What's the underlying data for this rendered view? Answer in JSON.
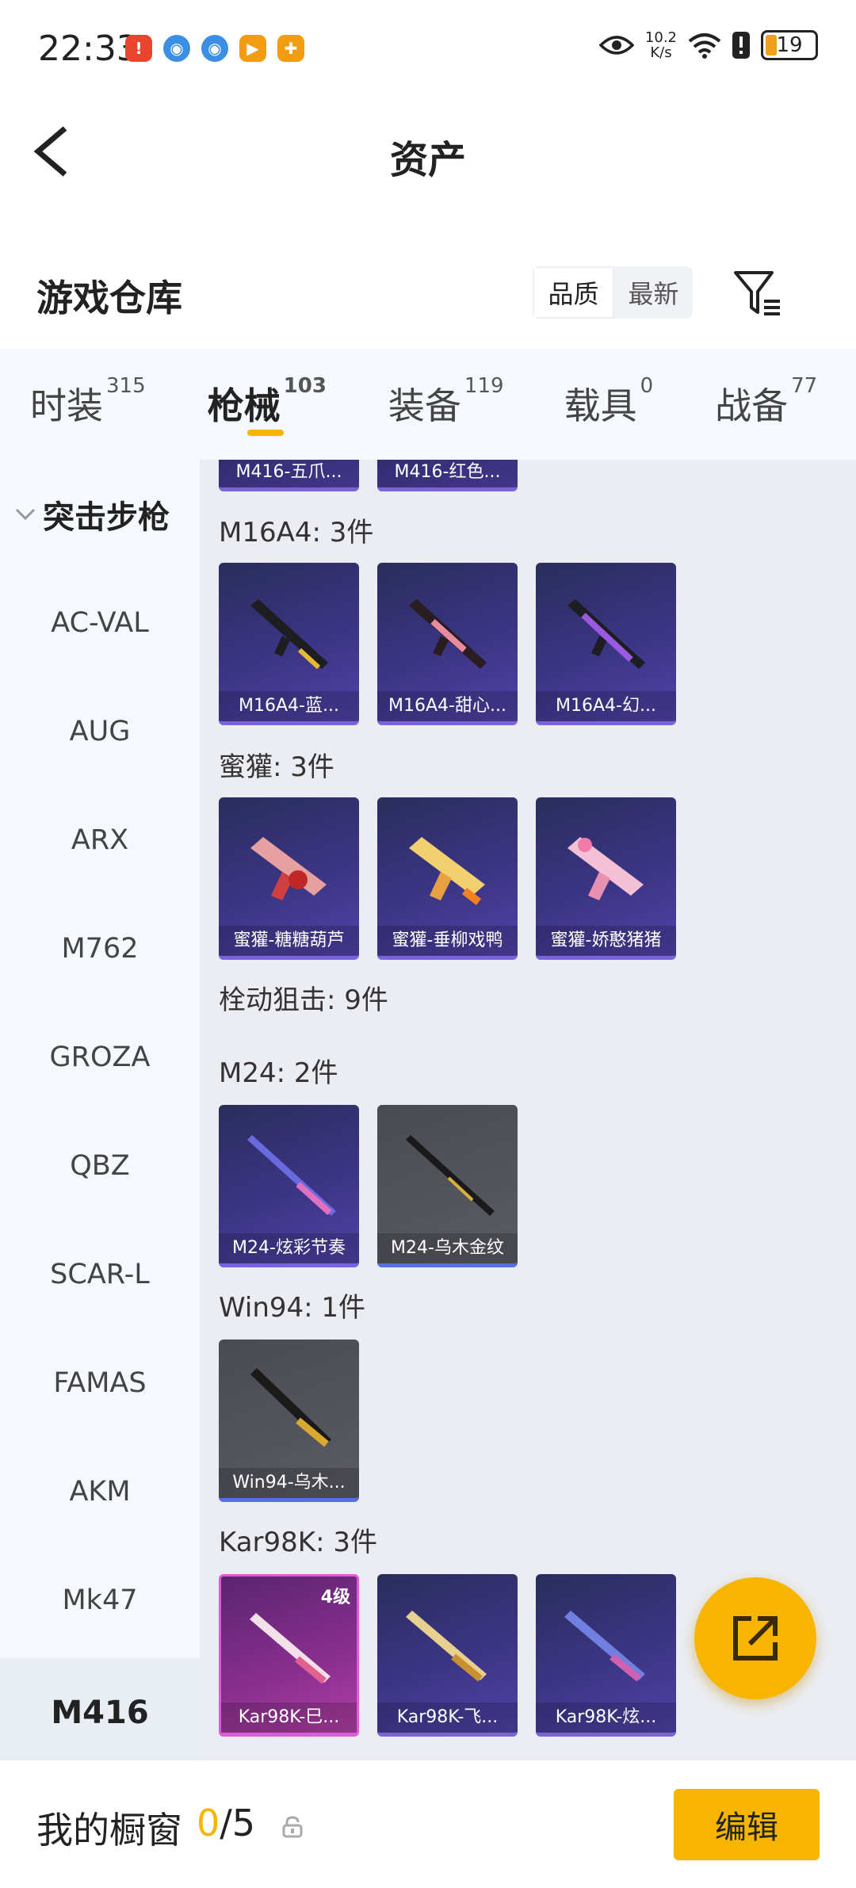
{
  "status_bar": {
    "time": "22:33",
    "net_speed_value": "10.2",
    "net_speed_unit": "K/s",
    "battery": "19",
    "app_icons": [
      "notification-red-icon",
      "blue-browser-icon",
      "blue-browser-icon",
      "orange-video-icon",
      "orange-game-icon"
    ],
    "icons": [
      "eye-icon",
      "wifi-icon",
      "alert-icon",
      "battery-icon"
    ]
  },
  "header": {
    "title": "资产",
    "back_icon": "chevron-left-icon"
  },
  "warehouse": {
    "title": "游戏仓库",
    "sort_options": [
      "品质",
      "最新"
    ],
    "active_sort": "品质",
    "filter_icon": "filter-icon"
  },
  "tabs": [
    {
      "label": "时装",
      "count": "315"
    },
    {
      "label": "枪械",
      "count": "103"
    },
    {
      "label": "装备",
      "count": "119"
    },
    {
      "label": "载具",
      "count": "0"
    },
    {
      "label": "战备",
      "count": "77"
    }
  ],
  "active_tab": "枪械",
  "sidebar": {
    "group": "突击步枪",
    "items": [
      "AC-VAL",
      "AUG",
      "ARX",
      "M762",
      "GROZA",
      "QBZ",
      "SCAR-L",
      "FAMAS",
      "AKM",
      "Mk47",
      "M416"
    ],
    "active": "M416"
  },
  "content": {
    "top_partial": [
      "M416-五爪...",
      "M416-红色..."
    ],
    "groups": [
      {
        "label": "M16A4: 3件",
        "items": [
          {
            "name": "M16A4-蓝...",
            "style": "purple"
          },
          {
            "name": "M16A4-甜心...",
            "style": "purple"
          },
          {
            "name": "M16A4-幻...",
            "style": "purple"
          }
        ]
      },
      {
        "label": "蜜獾: 3件",
        "items": [
          {
            "name": "蜜獾-糖糖葫芦",
            "style": "purple"
          },
          {
            "name": "蜜獾-垂柳戏鸭",
            "style": "purple"
          },
          {
            "name": "蜜獾-娇憨猪猪",
            "style": "purple"
          }
        ]
      },
      {
        "label": "栓动狙击: 9件",
        "items": []
      },
      {
        "label": "M24: 2件",
        "items": [
          {
            "name": "M24-炫彩节奏",
            "style": "purple"
          },
          {
            "name": "M24-乌木金纹",
            "style": "grey"
          }
        ]
      },
      {
        "label": "Win94: 1件",
        "items": [
          {
            "name": "Win94-乌木...",
            "style": "grey"
          }
        ]
      },
      {
        "label": "Kar98K: 3件",
        "items": [
          {
            "name": "Kar98K-巳...",
            "style": "pink",
            "level": "4级"
          },
          {
            "name": "Kar98K-飞...",
            "style": "purple"
          },
          {
            "name": "Kar98K-炫...",
            "style": "purple"
          }
        ]
      }
    ]
  },
  "fab": {
    "icon": "share-external-icon"
  },
  "bottom_bar": {
    "label": "我的橱窗",
    "current": "0",
    "total": "/5",
    "lock_icon": "lock-icon",
    "edit_label": "编辑"
  }
}
